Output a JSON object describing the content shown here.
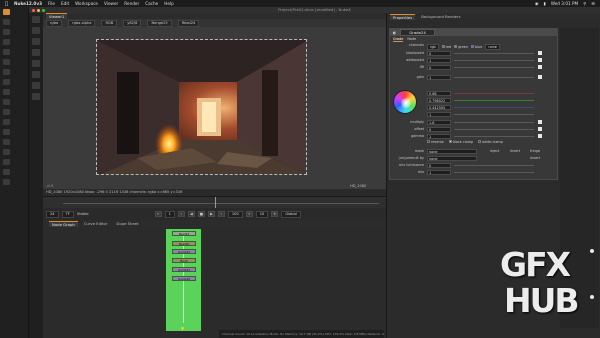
{
  "menubar": {
    "app_name": "Nuke12.0v3",
    "items": [
      "File",
      "Edit",
      "Workspace",
      "Viewer",
      "Render",
      "Cache",
      "Help"
    ],
    "clock": "Wed 3:01 PM"
  },
  "window": {
    "title": "Project/File01.nknc [modified] - NukeX"
  },
  "viewer": {
    "tab": "Viewer1",
    "channels": "rgba",
    "layer": "rgba.alpha",
    "colorspace": "RGB",
    "zoom": "y82/8",
    "mode": "Nenge25",
    "compare": "Read24",
    "frame_tag": "HD_1080",
    "info": "HD_1080 1920x1080 bbox: -296 0 2116 1338 channels: rgba      x=665 y=316",
    "image_label_tl": "cl.5"
  },
  "playbar": {
    "fps": "24",
    "mode": "TF",
    "visible_label": "Visible",
    "frame": "1",
    "end": "100",
    "step": "10",
    "range_label": "Global"
  },
  "graph": {
    "tabs": [
      "Node Graph",
      "Curve Editor",
      "Dope Sheet"
    ],
    "nodes": [
      "Read24",
      "Read20",
      "Grade24",
      "Blur8",
      "Grade24",
      "Grade26"
    ],
    "status": "Channel Count: 19  Localization Mode: On  Memory: 19.7 GB (31.2%)  CPU: 103.2%  Disk: 0.8 MB/s  Network: 0.0 MB/s"
  },
  "properties": {
    "tabs": [
      "Properties",
      "Background Renders"
    ],
    "node_name": "Grade24",
    "panel_tabs": [
      "Grade",
      "Node"
    ],
    "channels_label": "channels",
    "channels_value": "rgb",
    "channel_chips": [
      "red",
      "green",
      "blue"
    ],
    "channel_extra": "none",
    "knobs": [
      {
        "label": "blackpoint",
        "value": "0"
      },
      {
        "label": "whitepoint",
        "value": "1"
      },
      {
        "label": "lift",
        "value": "0"
      },
      {
        "label": "gain",
        "value": "1"
      },
      {
        "label": "",
        "value": "0.66"
      },
      {
        "label": "",
        "value": "0.798022"
      },
      {
        "label": "",
        "value": "0.442505"
      },
      {
        "label": "",
        "value": "1"
      },
      {
        "label": "multiply",
        "value": "1.6"
      },
      {
        "label": "offset",
        "value": "0"
      },
      {
        "label": "gamma",
        "value": "1"
      }
    ],
    "reverse_label": "reverse",
    "black_clamp_label": "black clamp",
    "white_clamp_label": "white clamp",
    "mask_label": "mask",
    "mask_value": "none",
    "inject_label": "inject",
    "invert_label": "invert",
    "fringe_label": "fringe",
    "unpremult_label": "(un)premult by",
    "unpremult_value": "none",
    "invert2_label": "invert",
    "mix_luminance_label": "mix luminance",
    "mix_luminance_value": "0",
    "mix_label": "mix",
    "mix_value": "1"
  },
  "watermark": {
    "line1": "GFX",
    "line2": "HUB"
  },
  "colors": {
    "accent": "#e18b2d",
    "graph_backdrop": "#5bd35b",
    "panel": "#2b2b2b"
  }
}
